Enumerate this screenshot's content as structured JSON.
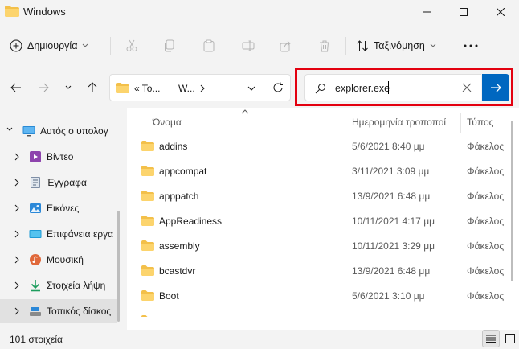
{
  "window": {
    "title": "Windows"
  },
  "commandbar": {
    "new_label": "Δημιουργία",
    "sort_label": "Ταξινόμηση",
    "more_label": "···"
  },
  "address": {
    "seg1": "«  To...",
    "seg2": "W..."
  },
  "search": {
    "value": "explorer.exe"
  },
  "nav": {
    "items": [
      {
        "label": "Αυτός ο υπολογ",
        "icon": "computer-icon"
      },
      {
        "label": "Βίντεο",
        "icon": "videos-icon"
      },
      {
        "label": "Έγγραφα",
        "icon": "documents-icon"
      },
      {
        "label": "Εικόνες",
        "icon": "pictures-icon"
      },
      {
        "label": "Επιφάνεια εργα",
        "icon": "desktop-icon"
      },
      {
        "label": "Μουσική",
        "icon": "music-icon"
      },
      {
        "label": "Στοιχεία λήψη",
        "icon": "downloads-icon"
      },
      {
        "label": "Τοπικός δίσκος",
        "icon": "local-disk-icon"
      }
    ]
  },
  "columns": {
    "name": "Όνομα",
    "date": "Ημερομηνία τροποποί",
    "type": "Τύπος"
  },
  "files": [
    {
      "name": "addins",
      "date": "5/6/2021 8:40 μμ",
      "type": "Φάκελος"
    },
    {
      "name": "appcompat",
      "date": "3/11/2021 3:09 μμ",
      "type": "Φάκελος"
    },
    {
      "name": "apppatch",
      "date": "13/9/2021 6:48 μμ",
      "type": "Φάκελος"
    },
    {
      "name": "AppReadiness",
      "date": "10/11/2021 4:17 μμ",
      "type": "Φάκελος"
    },
    {
      "name": "assembly",
      "date": "10/11/2021 3:29 μμ",
      "type": "Φάκελος"
    },
    {
      "name": "bcastdvr",
      "date": "13/9/2021 6:48 μμ",
      "type": "Φάκελος"
    },
    {
      "name": "Boot",
      "date": "5/6/2021 3:10 μμ",
      "type": "Φάκελος"
    }
  ],
  "status": {
    "count": "101 στοιχεία"
  },
  "colors": {
    "accent": "#0067c0",
    "highlight": "#e3000f",
    "folder": "#f3c04a"
  }
}
